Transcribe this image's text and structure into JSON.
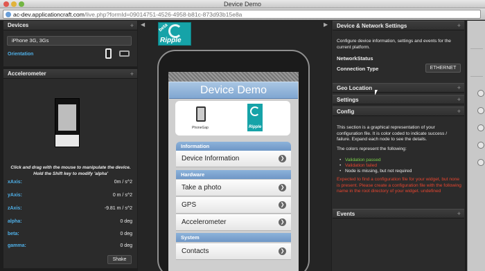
{
  "window": {
    "title": "Device Demo"
  },
  "url": {
    "domain": "ac-dev.applicationcraft.com",
    "path": "/live.php?formId=09014751-4526-4958-b81c-873d93b15e8a"
  },
  "devices": {
    "title": "Devices",
    "selected": "iPhone 3G, 3Gs",
    "orientation_label": "Orientation"
  },
  "accelerometer": {
    "title": "Accelerometer",
    "help_line1": "Click and drag with the mouse to manipulate the device.",
    "help_line2": "Hold the Shift key to modify 'alpha'",
    "rows": [
      {
        "k": "xAxis:",
        "v": "0m / s^2"
      },
      {
        "k": "yAxis:",
        "v": "0 m / s^2"
      },
      {
        "k": "zAxis:",
        "v": "-9.81 m / s^2"
      },
      {
        "k": "alpha:",
        "v": "0 deg"
      },
      {
        "k": "beta:",
        "v": "0 deg"
      },
      {
        "k": "gamma:",
        "v": "0 deg"
      }
    ],
    "shake_label": "Shake"
  },
  "center": {
    "logo": {
      "beta": "beta",
      "word": "Ripple"
    },
    "app_title": "Device Demo",
    "phonegap_text": "PhoneGap",
    "ripple_text": "Ripple",
    "sections": {
      "information": "Information",
      "hardware": "Hardware",
      "system": "System"
    },
    "items": {
      "device_info": "Device Information",
      "take_photo": "Take a photo",
      "gps": "GPS",
      "accelerometer": "Accelerometer",
      "contacts": "Contacts"
    },
    "chevron": "❯"
  },
  "right": {
    "dn_title": "Device & Network Settings",
    "dn_desc": "Configure device information, settings and events for the current platform.",
    "network_status": "NetworkStatus",
    "connection_type_label": "Connection Type",
    "connection_type_value": "ETHERNET",
    "geo": "Geo Location",
    "settings": "Settings",
    "config": "Config",
    "config_p1": "This section is a graphical representation of your configuration file. It is color coded to indicate success / failure. Expand each node to see the details.",
    "config_p2": "The colors represent the following:",
    "bullet_passed": "Validation passed",
    "bullet_failed": "Validation failed",
    "bullet_missing": "Node is missing, but not required",
    "config_error": "Expected to find a configuration file for your widget, but none is present. Please create a configuration file with the following name in the root directory of your widget. undefined",
    "events": "Events"
  },
  "colors": {
    "blue_label": "#4fb0e8",
    "passed": "#7cd34a",
    "failed": "#e8452f",
    "ripple": "#16a3a8"
  }
}
